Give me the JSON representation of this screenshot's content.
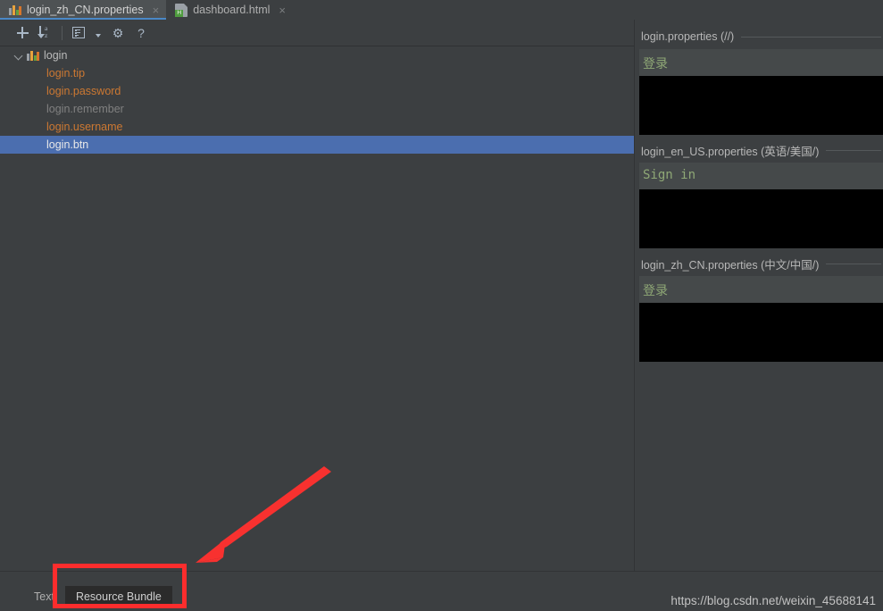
{
  "window": {
    "background": "#3c3f41",
    "accent": "#4b6eaf"
  },
  "editor_tabs": [
    {
      "label": "login_zh_CN.properties",
      "icon": "resource-bundle-icon",
      "active": true,
      "close": "×"
    },
    {
      "label": "dashboard.html",
      "icon": "html-file-icon",
      "badge": "H",
      "active": false,
      "close": "×"
    }
  ],
  "toolbar": {
    "add_label": "+",
    "sort_label": "a",
    "sort_label2": "z",
    "gear_label": "⚙",
    "help_label": "?",
    "items": [
      {
        "name": "add-property-button",
        "icon": "plus-icon"
      },
      {
        "name": "sort-alphabetically-button",
        "icon": "sort-az-icon"
      },
      {
        "name": "show-properties-button",
        "icon": "list-properties-icon"
      },
      {
        "name": "more-options-button",
        "icon": "chevron-down-icon"
      },
      {
        "name": "settings-button",
        "icon": "gear-icon"
      },
      {
        "name": "help-button",
        "icon": "question-mark-icon"
      }
    ]
  },
  "tree": {
    "root": {
      "label": "login",
      "icon": "resource-bundle-icon",
      "expanded": true
    },
    "items": [
      {
        "label": "login.tip",
        "state": "normal",
        "selected": false
      },
      {
        "label": "login.password",
        "state": "normal",
        "selected": false
      },
      {
        "label": "login.remember",
        "state": "inherited",
        "selected": false
      },
      {
        "label": "login.username",
        "state": "normal",
        "selected": false
      },
      {
        "label": "login.btn",
        "state": "normal",
        "selected": true
      }
    ]
  },
  "preview": {
    "blocks": [
      {
        "title": "login.properties (//)",
        "value": "登录"
      },
      {
        "title": "login_en_US.properties (英语/美国/)",
        "value": "Sign in"
      },
      {
        "title": "login_zh_CN.properties (中文/中国/)",
        "value": "登录"
      }
    ]
  },
  "bottom_tabs": [
    {
      "label": "Text",
      "active": false
    },
    {
      "label": "Resource Bundle",
      "active": true
    }
  ],
  "watermark": "https://blog.csdn.net/weixin_45688141",
  "annotations": {
    "highlight_color": "#fc2d2d",
    "target": "Resource Bundle"
  }
}
